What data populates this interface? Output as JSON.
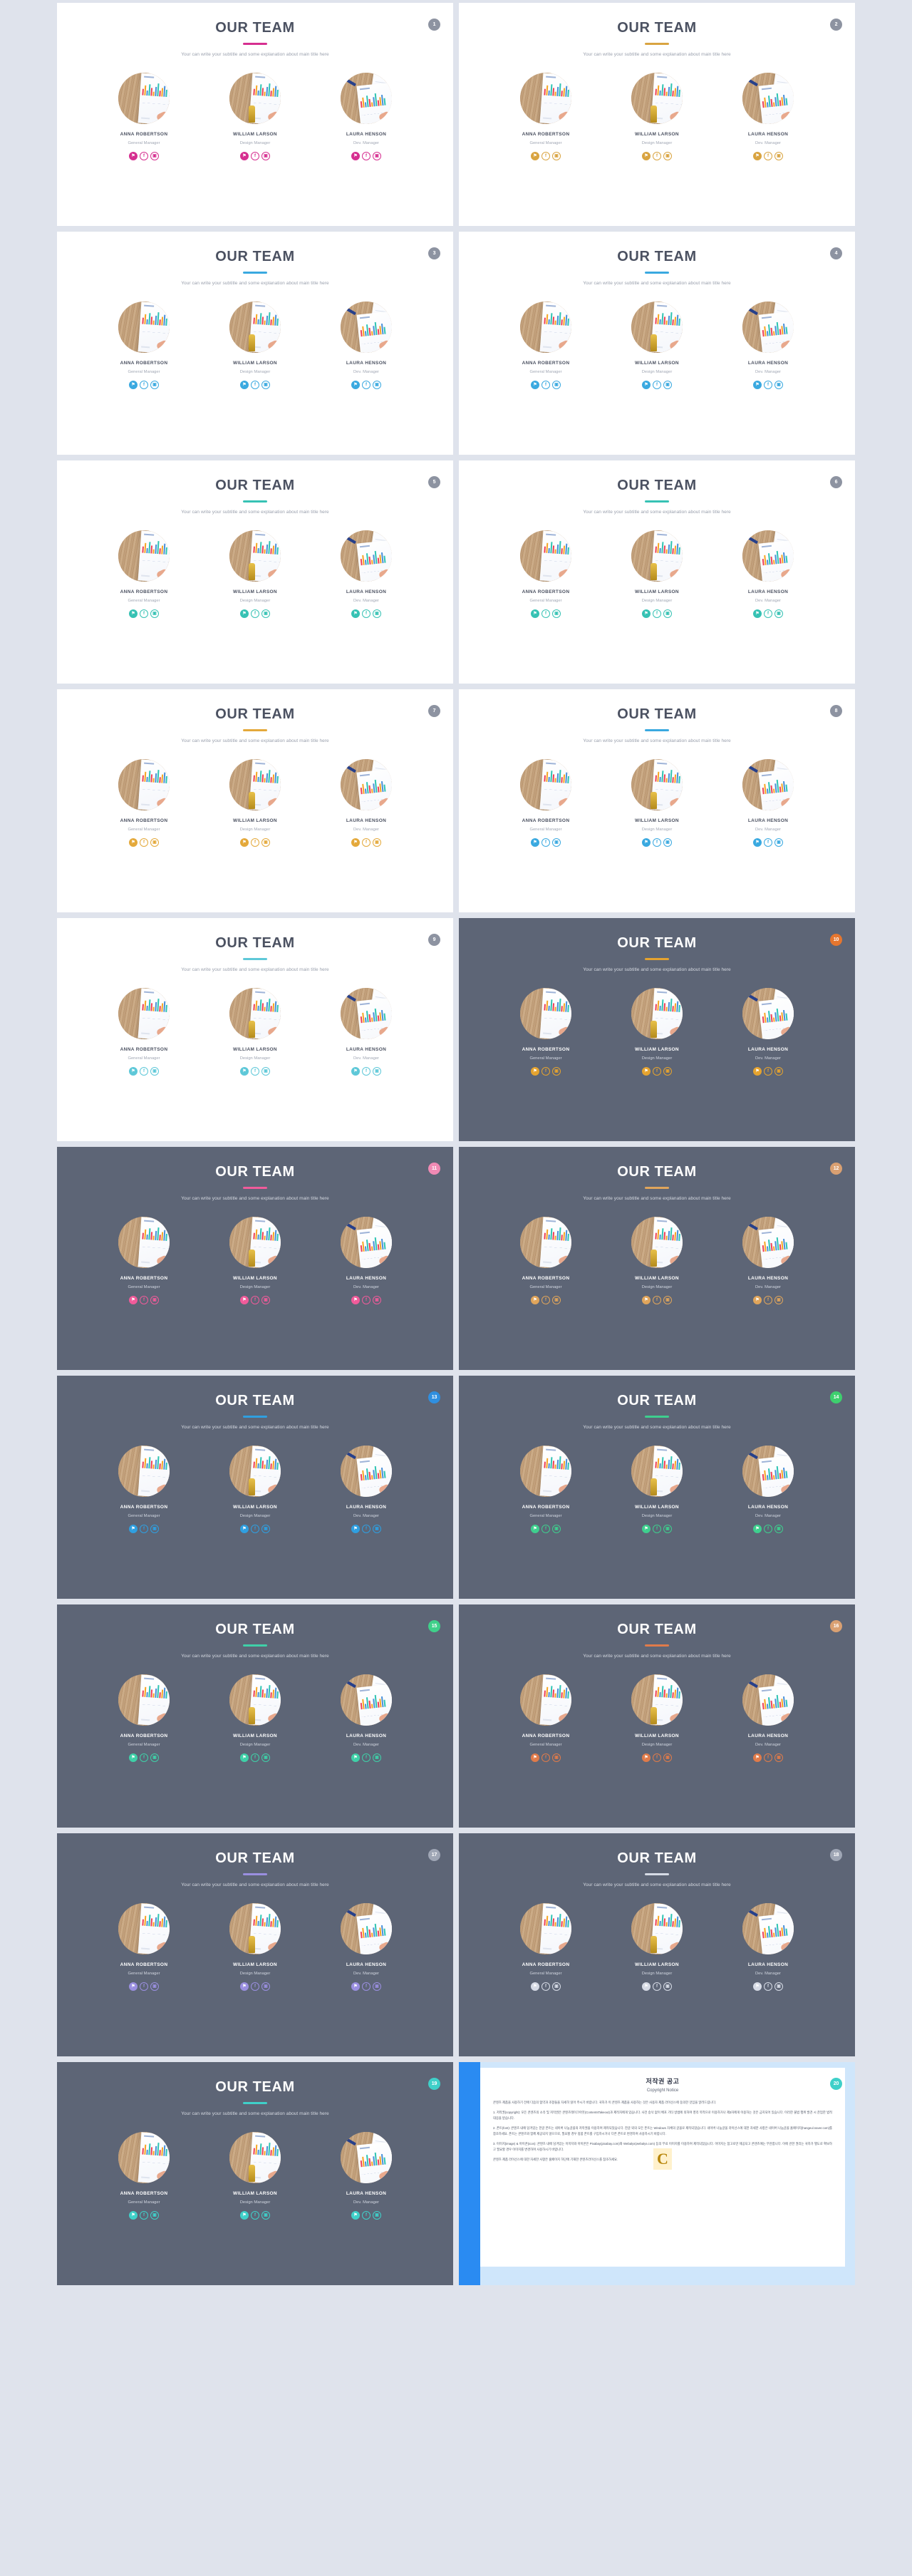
{
  "page": {
    "background": "#dfe3ec",
    "layout": "2-column thumbnail grid of presentation slides"
  },
  "slide_common": {
    "title": "OUR TEAM",
    "subtitle": "Your can write your subtitle and some explanation about main title here",
    "members": [
      {
        "name": "ANNA ROBERTSON",
        "role": "General Manager"
      },
      {
        "name": "WILLIAM LARSON",
        "role": "Design Manager"
      },
      {
        "name": "LAURA HENSON",
        "role": "Dev. Manager"
      }
    ],
    "socials": [
      {
        "name": "twitter-icon",
        "glyph": "⚑"
      },
      {
        "name": "facebook-icon",
        "glyph": "f"
      },
      {
        "name": "instagram-icon",
        "glyph": "▣"
      }
    ]
  },
  "slides": [
    {
      "number": "1",
      "theme": "light",
      "accent": "#d62f90",
      "badge": "#8d93a1"
    },
    {
      "number": "2",
      "theme": "light",
      "accent": "#d9a441",
      "badge": "#8d93a1"
    },
    {
      "number": "3",
      "theme": "light",
      "accent": "#3aa9e0",
      "badge": "#8d93a1"
    },
    {
      "number": "4",
      "theme": "light",
      "accent": "#3aa9e0",
      "badge": "#8d93a1"
    },
    {
      "number": "5",
      "theme": "light",
      "accent": "#37c2b4",
      "badge": "#8d93a1"
    },
    {
      "number": "6",
      "theme": "light",
      "accent": "#37c2b4",
      "badge": "#8d93a1"
    },
    {
      "number": "7",
      "theme": "light",
      "accent": "#e4a93b",
      "badge": "#8d93a1"
    },
    {
      "number": "8",
      "theme": "light",
      "accent": "#3aa9e0",
      "badge": "#8d93a1"
    },
    {
      "number": "9",
      "theme": "light",
      "accent": "#5ec8d8",
      "badge": "#8d93a1"
    },
    {
      "number": "10",
      "theme": "dark",
      "accent": "#e5a32f",
      "badge": "#e5762f"
    },
    {
      "number": "11",
      "theme": "dark",
      "accent": "#f05b9a",
      "badge": "#f08ab4"
    },
    {
      "number": "12",
      "theme": "dark",
      "accent": "#e0a55b",
      "badge": "#d9a072"
    },
    {
      "number": "13",
      "theme": "dark",
      "accent": "#2f9fe0",
      "badge": "#2f8fe0"
    },
    {
      "number": "14",
      "theme": "dark",
      "accent": "#3ecf8e",
      "badge": "#3ecf6e"
    },
    {
      "number": "15",
      "theme": "dark",
      "accent": "#3fd0a8",
      "badge": "#3fd08a"
    },
    {
      "number": "16",
      "theme": "dark",
      "accent": "#e07b4a",
      "badge": "#d9a072"
    },
    {
      "number": "17",
      "theme": "dark",
      "accent": "#9a8fe0",
      "badge": "#9fa6b5"
    },
    {
      "number": "18",
      "theme": "dark",
      "accent": "#d6dbe6",
      "badge": "#9fa6b5"
    },
    {
      "number": "19",
      "theme": "dark",
      "accent": "#3fd0c9",
      "badge": "#3fd0c9"
    }
  ],
  "copyright_slide": {
    "number": "20",
    "badge": "#3fd0c9",
    "title": "저작권 공고",
    "subtitle": "Copyright Notice",
    "watermark": "C",
    "paragraphs": [
      "콘텐츠 제품을 사용하기 전에 다음의 협약과 조항들을 자세히 읽어 주시기 바랍니다. 귀하가 이 콘텐츠 제품을 사용하는 것은 사용자 제품 라이선스에 동의한 것임을 알려드립니다.",
      "1. 저작권(copyright): 모든 콘텐츠의 소유 및 저작권은 콘텐츠테이크아웃(ContentsTakeout)과 제작자에게 있습니다. 사전 승낙 없이 배포 기타 방법에 의하여 영리 목적으로 이용하거나 제3자에게 이용하는 것은 금지되어 있습니다. 이러한 불법 행위 발견 시 준엄한 법적 대응을 받습니다.",
      "2. 폰트(font): 콘텐츠 내에 담겨있는 한글 폰트는 네이버 나눔글꼴의 저작권을 이용하여 제작되었습니다. 한글 외의 모든 폰트는 Windows 자체의 글꼴로 제작되었습니다. 네이버 나눔글꼴 라이선스에 대한 자세한 사항은 네이버 나눔글꼴 홈페이지(hangeul.naver.com)를 참조하세요. 폰트는 콘텐츠와 함께 제공되지 않으므로, 필요할 경우 정품 폰트를 구입하시거나 다른 폰트로 변경하여 사용하시기 바랍니다.",
      "3. 이미지(image) & 아이콘(icon): 콘텐츠 내에 담겨있는 이미지와 아이콘은 Pixabay(pixabay.com)와 Webalys(webalys.com) 등의 무료 이미지를 이용하여 제작되었습니다. 이미지는 참고로만 제공되고 콘텐츠에는 무관합니다. 이에 관한 권리는 귀하가 별도로 확보하고 필요할 경우 이미지를 변경하여 사용하시기 바랍니다.",
      "콘텐츠 제품 라이선스에 대한 자세한 사항은 홈페이지 하단에 기재한 콘텐츠라이선스를 참조하세요."
    ]
  },
  "chart_thumbnail": {
    "type": "bar",
    "note": "decorative bar chart printed on the paper inside each member photo",
    "categories": [
      "1",
      "2",
      "3",
      "4",
      "5",
      "6",
      "7",
      "8",
      "9",
      "10",
      "11",
      "12"
    ],
    "values": [
      9,
      14,
      7,
      16,
      11,
      6,
      13,
      18,
      8,
      12,
      15,
      10
    ],
    "colors": [
      "#ef4056",
      "#f6a623",
      "#4a90d9",
      "#2fc4b2",
      "#ef4056",
      "#f6a623",
      "#4a90d9",
      "#2fc4b2",
      "#ef4056",
      "#f6a623",
      "#4a90d9",
      "#2fc4b2"
    ]
  }
}
